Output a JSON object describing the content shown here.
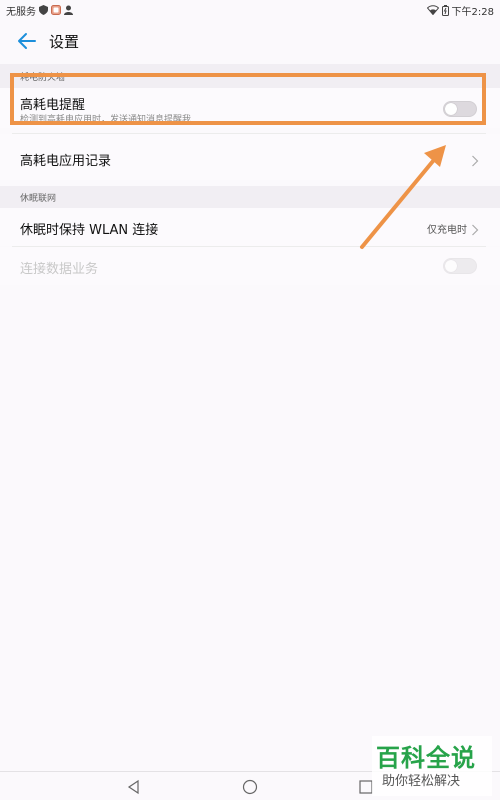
{
  "status_bar": {
    "carrier": "无服务",
    "time": "下午2:28",
    "icons": [
      "shield-icon",
      "app-notification-icon",
      "person-icon",
      "wifi-icon",
      "battery-icon"
    ]
  },
  "header": {
    "back_icon": "arrow-left-icon",
    "title": "设置"
  },
  "sections": [
    {
      "header": "耗电防火墙",
      "items": [
        {
          "title": "高耗电提醒",
          "subtitle": "检测到高耗电应用时，发送通知消息提醒我",
          "control": "toggle",
          "checked": false
        },
        {
          "title": "高耗电应用记录",
          "control": "chevron"
        }
      ]
    },
    {
      "header": "休眠联网",
      "items": [
        {
          "title": "休眠时保持 WLAN 连接",
          "value": "仅充电时",
          "control": "chevron"
        },
        {
          "title": "连接数据业务",
          "control": "toggle",
          "checked": false,
          "disabled": true
        }
      ]
    }
  ],
  "nav_bar": {
    "icons": [
      "back-triangle-icon",
      "home-circle-icon",
      "recents-square-icon"
    ]
  },
  "watermark": {
    "title": "百科全说",
    "subtitle": "助你轻松解决"
  },
  "colors": {
    "accent": "#1c8fdb",
    "highlight": "#ee9347",
    "watermark_green": "#27a34a"
  }
}
